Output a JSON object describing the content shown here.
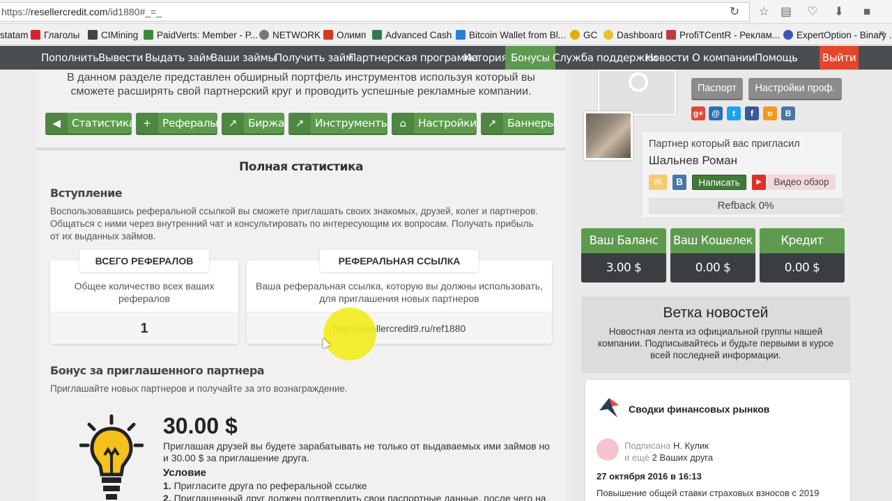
{
  "browser": {
    "url_prefix": "https://",
    "url_host": "resellercredit.com",
    "url_path": "/id1880#_=_",
    "bookmarks": [
      {
        "label": "statam",
        "color": "#c8c8c8"
      },
      {
        "label": "Глаголы",
        "color": "#d6262b"
      },
      {
        "label": "CIMining",
        "color": "#444444"
      },
      {
        "label": "PaidVerts: Member - P...",
        "color": "#3b8a3b"
      },
      {
        "label": "NETWORK",
        "color": "#777777"
      },
      {
        "label": "Олимп",
        "color": "#d63a1e"
      },
      {
        "label": "Advanced Cash",
        "color": "#2f7a4a"
      },
      {
        "label": "Bitcoin Wallet from Bl...",
        "color": "#2a7fd4"
      },
      {
        "label": "GC",
        "color": "#e0b000"
      },
      {
        "label": "Dashboard",
        "color": "#e8c030"
      },
      {
        "label": "ProfiTCentR - Реклам...",
        "color": "#c03a3a"
      },
      {
        "label": "ExpertOption - Binary ...",
        "color": "#3a58b8"
      }
    ],
    "more": "»"
  },
  "nav": {
    "items": [
      "Пополнить",
      "Вывести",
      "Выдать займ",
      "Ваши займы",
      "Получить займ",
      "Партнерская программа",
      "История",
      "Бонусы",
      "Служба поддержки",
      "Новости",
      "О компании",
      "Помощь"
    ],
    "logout": "Выйти",
    "active_index": 7
  },
  "main": {
    "intro": "В данном разделе представлен обширный портфель инструментов используя который вы сможете расширять свой партнерский круг и проводить успешные рекламные компании.",
    "tools": [
      {
        "label": "Статистика",
        "icon": "megaphone-icon",
        "glyph": "◀"
      },
      {
        "label": "Рефералы",
        "icon": "add-user-icon",
        "glyph": "+"
      },
      {
        "label": "Биржа",
        "icon": "share-icon",
        "glyph": "↗"
      },
      {
        "label": "Инструменты",
        "icon": "chart-icon",
        "glyph": "↗"
      },
      {
        "label": "Настройки",
        "icon": "home-icon",
        "glyph": "⌂"
      },
      {
        "label": "Баннеры",
        "icon": "chart-icon",
        "glyph": "↗"
      }
    ],
    "full_stats_title": "Полная статистика",
    "intro_section": {
      "title": "Вступление",
      "text": "Воспользовавшись реферальной ссылкой вы сможете приглашать своих знакомых, друзей, колег и партнеров. Общаться с ними через внутренний чат и консультировать по интересующим их вопросам. Получать прибыль от их выданных займов."
    },
    "card_total": {
      "tab": "ВСЕГО РЕФЕРАЛОВ",
      "desc": "Общее количество всех ваших рефералов",
      "value": "1"
    },
    "card_link": {
      "tab": "РЕФЕРАЛЬНАЯ ССЫЛКА",
      "desc": "Ваша реферальная ссылка, которую вы должны использовать, для приглашения новых партнеров",
      "value": "http://resellercredit9.ru/ref1880"
    },
    "bonus_section": {
      "title": "Бонус за приглашенного партнера",
      "text": "Приглашайте новых партнеров и получайте за это вознаграждение."
    },
    "bonus": {
      "amount": "30.00 $",
      "text": "Приглашая друзей вы будете зарабатывать не только от выдаваемых ими займов но и 30.00 $ за приглашение друга.",
      "condition_title": "Условие",
      "conditions": [
        {
          "num": "1.",
          "text": "Пригласите друга по реферальной ссылке"
        },
        {
          "num": "2.",
          "text": "Приглашенный друг должен подтвердить свои паспортные данные, после чего на"
        }
      ]
    }
  },
  "sidebar": {
    "passport_btn": "Паспорт",
    "profile_btn": "Настройки проф.",
    "socials": [
      {
        "name": "google-plus-icon",
        "glyph": "g+",
        "color": "#dd4b39"
      },
      {
        "name": "mail-icon",
        "glyph": "@",
        "color": "#2a6fb4"
      },
      {
        "name": "twitter-icon",
        "glyph": "t",
        "color": "#1da1f2"
      },
      {
        "name": "facebook-icon",
        "glyph": "f",
        "color": "#3b5998"
      },
      {
        "name": "odnoklassniki-icon",
        "glyph": "o",
        "color": "#f39a1e"
      },
      {
        "name": "vk-icon",
        "glyph": "B",
        "color": "#4a76a8"
      }
    ],
    "inviter": {
      "label": "Партнер который вас пригласил",
      "name": "Шальнев Роман",
      "write_btn": "Написать",
      "video_btn": "Видео обзор",
      "refback": "Refback 0%"
    },
    "balances": [
      {
        "title": "Ваш Баланс",
        "value": "3.00 $"
      },
      {
        "title": "Ваш Кошелек",
        "value": "0.00 $"
      },
      {
        "title": "Кредит",
        "value": "0.00 $"
      }
    ],
    "news": {
      "title": "Ветка новостей",
      "desc": "Новостная лента из официальной группы нашей компании. Подписывайтесь и будьте первыми в курсе всей последней информации."
    },
    "feed": {
      "title": "Сводки финансовых рынков",
      "sub_prefix": "Подписана",
      "sub_name": "Н. Кулик",
      "sub_more_prefix": "и ещё",
      "sub_more": "2 Ваших друга",
      "date": "27 октября 2016 в 16:13",
      "text": "Повышение общей ставки страховых взносов с 2019"
    }
  },
  "colors": {
    "accent_green": "#5d9a4e",
    "nav_bg": "#4a4d52",
    "logout_red": "#e5452b",
    "balance_dark": "#3a3d42"
  }
}
